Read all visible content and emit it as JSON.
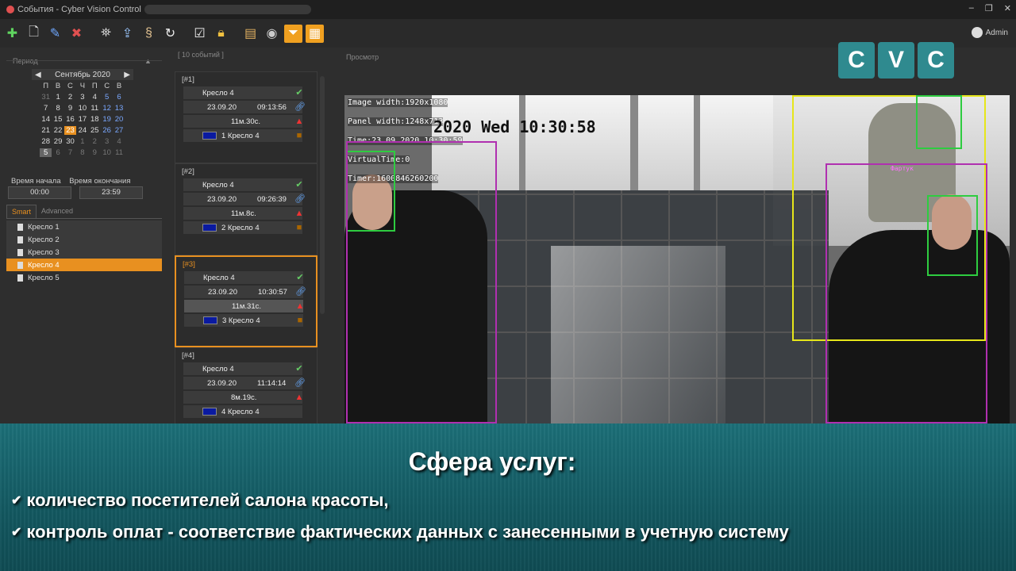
{
  "window": {
    "title": "События - Cyber Vision Control",
    "controls": [
      "–",
      "❐",
      "✕"
    ]
  },
  "toolbar": {
    "buttons": [
      "add-icon",
      "new-document-icon",
      "edit-icon",
      "delete-icon",
      "binoculars-icon",
      "export-icon",
      "scroll-icon",
      "refresh-icon",
      "checklist-icon",
      "lock-icon",
      "folder-icon",
      "eye-icon",
      "filter-icon",
      "calendar-view-icon"
    ],
    "user": "Admin"
  },
  "left": {
    "period_label": "Период",
    "month": "Сентябрь 2020",
    "prev": "◀",
    "next": "▶",
    "collapse": "▲",
    "weekdays": [
      "П",
      "В",
      "С",
      "Ч",
      "П",
      "С",
      "В"
    ],
    "days": [
      [
        "31",
        "1",
        "2",
        "3",
        "4",
        "5",
        "6"
      ],
      [
        "7",
        "8",
        "9",
        "10",
        "11",
        "12",
        "13"
      ],
      [
        "14",
        "15",
        "16",
        "17",
        "18",
        "19",
        "20"
      ],
      [
        "21",
        "22",
        "23",
        "24",
        "25",
        "26",
        "27"
      ],
      [
        "28",
        "29",
        "30",
        "1",
        "2",
        "3",
        "4"
      ],
      [
        "5",
        "6",
        "7",
        "8",
        "9",
        "10",
        "11"
      ]
    ],
    "start_label": "Время начала",
    "end_label": "Время окончания",
    "start_value": "00:00",
    "end_value": "23:59",
    "tabs": [
      "Smart",
      "Advanced"
    ],
    "items": [
      "Кресло 1",
      "Кресло 2",
      "Кресло 3",
      "Кресло 4",
      "Кресло 5"
    ]
  },
  "events": {
    "header": "[ 10 событий ]",
    "cards": [
      {
        "idx": "[#1]",
        "name": "Кресло 4",
        "date": "23.09.20",
        "time": "09:13:56",
        "duration": "11м.30с.",
        "label": "1 Кресло 4"
      },
      {
        "idx": "[#2]",
        "name": "Кресло 4",
        "date": "23.09.20",
        "time": "09:26:39",
        "duration": "11м.8с.",
        "label": "2 Кресло 4"
      },
      {
        "idx": "[#3]",
        "name": "Кресло 4",
        "date": "23.09.20",
        "time": "10:30:57",
        "duration": "11м.31с.",
        "label": "3 Кресло 4"
      },
      {
        "idx": "[#4]",
        "name": "Кресло 4",
        "date": "23.09.20",
        "time": "11:14:14",
        "duration": "8м.19с.",
        "label": "4 Кресло 4"
      }
    ]
  },
  "viewer": {
    "label": "Просмотр",
    "osd": {
      "image_width": "Image width:1920x1080",
      "panel_width": "Panel width:1248x713",
      "time": "Time:23.09.2020 10:30:59",
      "virtual_time": "VirtualTime:0",
      "timer": "Timer:1600846260200",
      "timestamp": "2020 Wed 10:30:58"
    },
    "tag": "Фартук"
  },
  "logo": [
    "C",
    "V",
    "C"
  ],
  "banner": {
    "title": "Сфера услуг:",
    "bullets": [
      "количество посетителей салона красоты,",
      "контроль оплат - соответствие фактических данных с занесенными в учетную систему"
    ]
  },
  "colors": {
    "accent": "#e89020",
    "banner": "#1c6f78",
    "logo": "#2f8a8f"
  }
}
